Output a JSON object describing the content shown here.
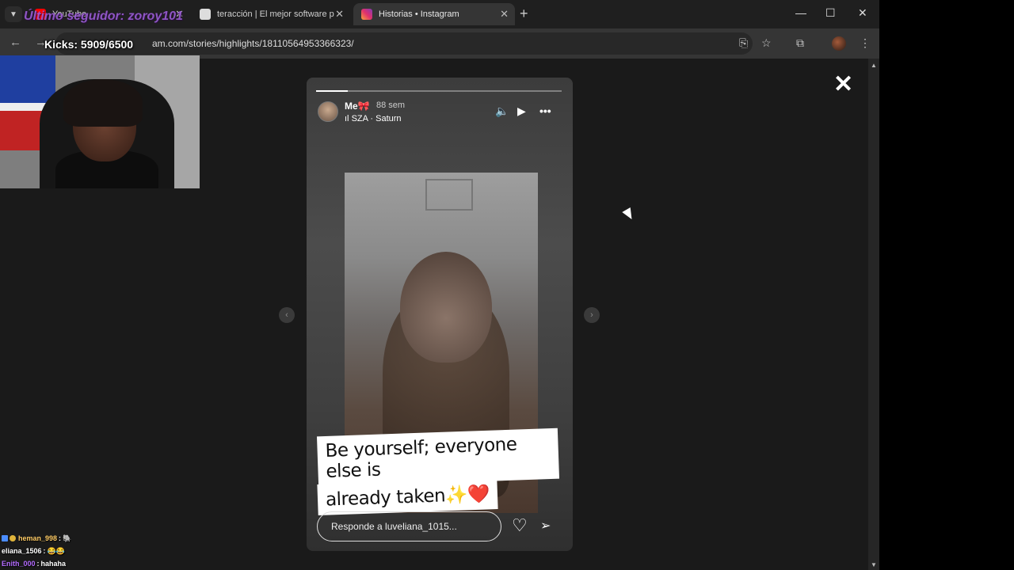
{
  "browser": {
    "tabs": [
      {
        "label": "YouTube",
        "favicon_color": "#ff0000"
      },
      {
        "label": "teracción | El mejor software p",
        "favicon_color": "#dddddd"
      },
      {
        "label": "Historias • Instagram",
        "favicon_color": "#e1306c",
        "active": true
      }
    ],
    "tab_close": "✕",
    "new_tab": "+",
    "url": "am.com/stories/highlights/18110564953366323/",
    "window_controls": {
      "minimize": "—",
      "maximize": "☐",
      "close": "✕"
    }
  },
  "story": {
    "username": "Me🎀",
    "time_ago": "88 sem",
    "song": "SZA · Saturn",
    "progress": 0.13,
    "caption_line1": "Be yourself; everyone else is",
    "caption_line2": "already taken✨❤️",
    "reply_placeholder": "Responde a luveliana_1015...",
    "close_label": "✕"
  },
  "overlay": {
    "kicks": "Kicks: 5909/6500",
    "last_follower": "Último seguidor: zoroy101"
  },
  "chat": [
    {
      "user": "heman_998",
      "message": "🐘",
      "color": "#ffcc66"
    },
    {
      "user": "eliana_1506",
      "message": "😂😂",
      "color": "#ffffff"
    },
    {
      "user": "Enith_000",
      "message": "hahaha",
      "color": "#b46cff"
    }
  ],
  "colors": {
    "accent": "#e1306c",
    "page_bg": "#1a1a1a"
  }
}
